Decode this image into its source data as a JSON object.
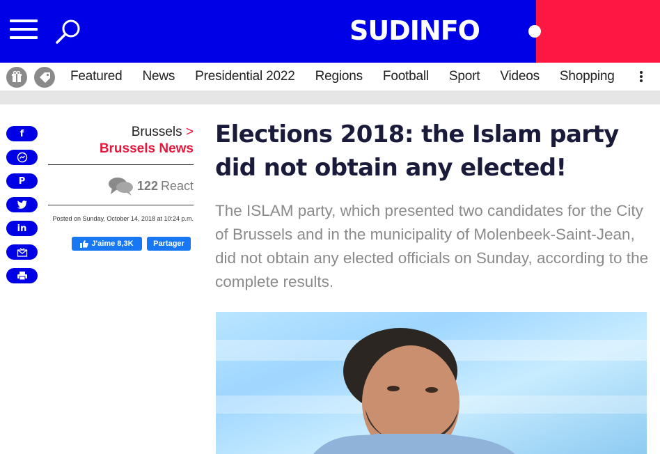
{
  "header": {
    "logo": "SUDINFO",
    "menu_icon": "hamburger-menu-icon",
    "search_icon": "search-icon",
    "brand_blue": "#0000e6",
    "brand_red": "#ff1744"
  },
  "nav": {
    "icons": [
      "gift-icon",
      "tag-icon"
    ],
    "items": [
      "Featured",
      "News",
      "Presidential 2022",
      "Regions",
      "Football",
      "Sport",
      "Videos",
      "Shopping"
    ],
    "more_icon": "kebab-menu-icon"
  },
  "share": {
    "buttons": [
      "facebook-icon",
      "messenger-icon",
      "pinterest-icon",
      "twitter-icon",
      "linkedin-icon",
      "email-icon",
      "print-icon"
    ],
    "glyphs": [
      "f",
      "✉",
      "P",
      "t",
      "in",
      "✉",
      "⎙"
    ]
  },
  "meta": {
    "breadcrumb_parent": "Brussels",
    "breadcrumb_arrow": ">",
    "breadcrumb_child": "Brussels News",
    "react_count": "122",
    "react_label": "React",
    "posted": "Posted on Sunday, October 14, 2018 at 10:24 p.m.",
    "like_label": "J'aime 8,3K",
    "share_label": "Partager"
  },
  "article": {
    "headline": "Elections 2018: the Islam party did not obtain any elected!",
    "lead": "The ISLAM party, which presented two candidates for the City of Brussels and in the municipality of Molenbeek-Saint-Jean, did not obtain any elected officials on Sunday, according to the complete results."
  }
}
